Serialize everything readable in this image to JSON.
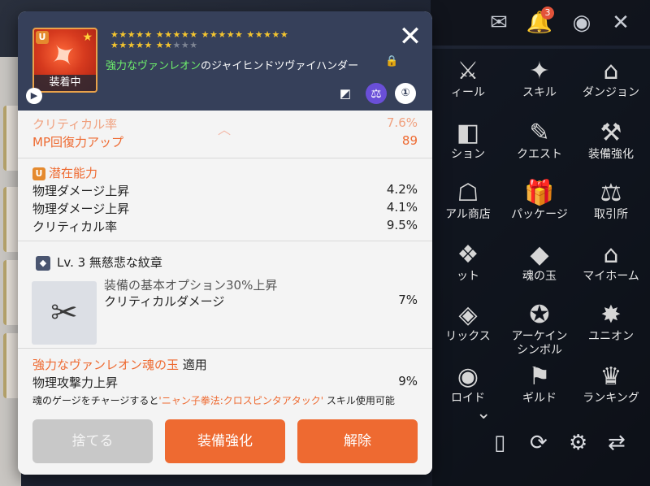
{
  "background": {
    "top_icons": [
      {
        "name": "mail-icon",
        "glyph": "✉"
      },
      {
        "name": "bell-icon",
        "glyph": "🔔",
        "badge": "3"
      },
      {
        "name": "bag-icon",
        "glyph": "◉"
      },
      {
        "name": "close-icon",
        "glyph": "✕"
      }
    ],
    "menu": [
      {
        "label": "ィール",
        "icon": "⚔"
      },
      {
        "label": "スキル",
        "icon": "✦"
      },
      {
        "label": "ダンジョン",
        "icon": "⌂"
      },
      {
        "label": "ション",
        "icon": "◧"
      },
      {
        "label": "クエスト",
        "icon": "✎"
      },
      {
        "label": "装備強化",
        "icon": "⚒"
      },
      {
        "label": "アル商店",
        "icon": "☖"
      },
      {
        "label": "パッケージ",
        "icon": "🎁"
      },
      {
        "label": "取引所",
        "icon": "⚖"
      },
      {
        "label": "ット",
        "icon": "❖"
      },
      {
        "label": "魂の玉",
        "icon": "◆"
      },
      {
        "label": "マイホーム",
        "icon": "⌂"
      },
      {
        "label": "リックス",
        "icon": "◈"
      },
      {
        "label": "アーケイン\nシンボル",
        "icon": "✪"
      },
      {
        "label": "ユニオン",
        "icon": "✸"
      },
      {
        "label": "ロイド",
        "icon": "◉"
      },
      {
        "label": "ギルド",
        "icon": "⚑"
      },
      {
        "label": "ランキング",
        "icon": "♛"
      }
    ]
  },
  "dialog": {
    "item": {
      "tier": "U",
      "equipped_label": "装着中",
      "name_highlight": "強力なヴァンレオン",
      "name_rest": "のジャイヒンドツヴァイハンダー",
      "stars_filled": 22,
      "stars_total": 25
    },
    "potential_title": "潜在能力",
    "rows_top": [
      {
        "label": "クリティカル率",
        "value": "7.6%"
      },
      {
        "label": "MP回復力アップ",
        "value": "89"
      }
    ],
    "potential": [
      {
        "label": "物理ダメージ上昇",
        "value": "4.2%"
      },
      {
        "label": "物理ダメージ上昇",
        "value": "4.1%"
      },
      {
        "label": "クリティカル率",
        "value": "9.5%"
      }
    ],
    "emblem": {
      "title": "Lv. 3 無慈悲な紋章",
      "line1": "装備の基本オプション30%上昇",
      "line2_label": "クリティカルダメージ",
      "line2_value": "7%"
    },
    "soul": {
      "name": "強力なヴァンレオン魂の玉",
      "applied": "適用",
      "stat_label": "物理攻撃力上昇",
      "stat_value": "9%",
      "desc_pre": "魂のゲージをチャージすると",
      "desc_skill": "'ニャン子拳法:クロスピンタアタック'",
      "desc_post": " スキル使用可能"
    },
    "buttons": {
      "discard": "捨てる",
      "enhance": "装備強化",
      "unequip": "解除"
    }
  }
}
